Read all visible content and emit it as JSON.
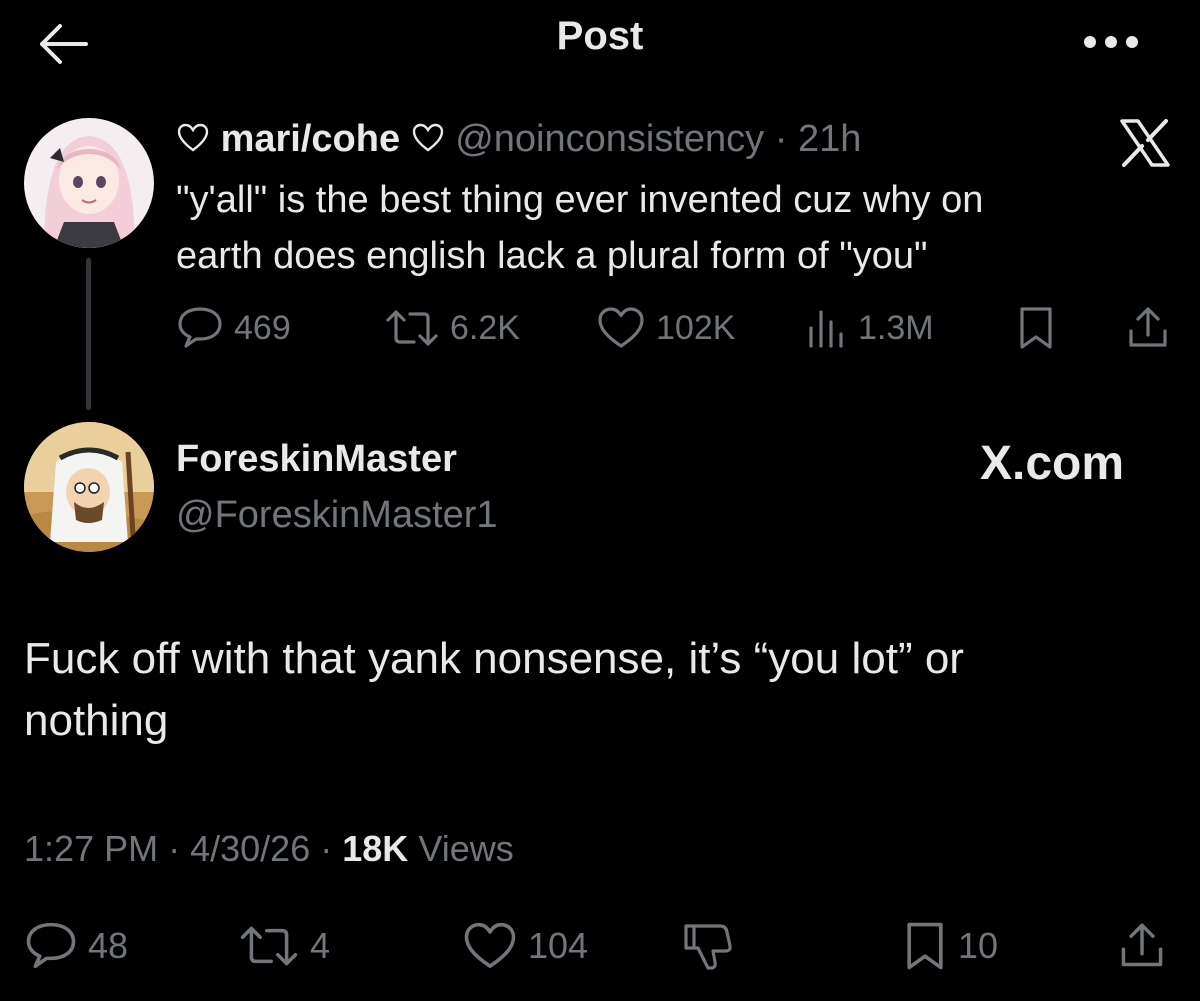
{
  "header": {
    "title": "Post",
    "back_icon": "arrow-left-icon",
    "more_icon": "more-horizontal-icon"
  },
  "parent_post": {
    "display_name": "mari/cohe",
    "handle": "@noinconsistency",
    "separator": "·",
    "age": "21h",
    "text_line1": "\"y'all\" is the best thing ever invented cuz why on",
    "text_line2": "earth does english lack a plural form of \"you\"",
    "stats": {
      "replies": "469",
      "reposts": "6.2K",
      "likes": "102K",
      "views": "1.3M"
    },
    "watermark_icon": "x-logo-icon"
  },
  "main_post": {
    "display_name": "ForeskinMaster",
    "handle": "@ForeskinMaster1",
    "watermark": "X.com",
    "text_line1": "Fuck off with that yank nonsense, it’s “you lot” or",
    "text_line2": "nothing",
    "time": "1:27 PM",
    "date": "4/30/26",
    "separator": "·",
    "views_count": "18K",
    "views_label": "Views",
    "stats": {
      "replies": "48",
      "reposts": "4",
      "likes": "104",
      "bookmarks": "10"
    }
  },
  "colors": {
    "background": "#000000",
    "text_primary": "#e7e9ea",
    "text_muted": "#71767b",
    "thread_line": "#333639"
  }
}
